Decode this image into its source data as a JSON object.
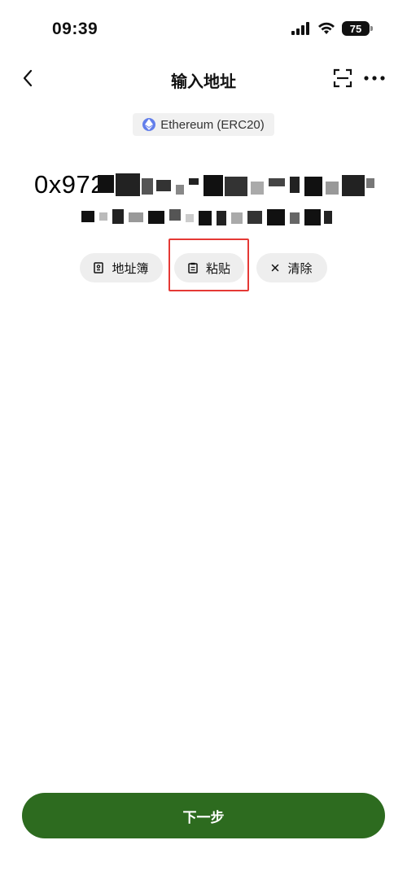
{
  "status_bar": {
    "time": "09:39",
    "battery": "75"
  },
  "nav": {
    "title": "输入地址"
  },
  "network": {
    "label": "Ethereum (ERC20)",
    "icon": "ethereum-icon",
    "color": "#627eea"
  },
  "address": {
    "visible_prefix": "0x972"
  },
  "actions": {
    "address_book_label": "地址簿",
    "paste_label": "粘贴",
    "clear_label": "清除"
  },
  "footer": {
    "next_label": "下一步",
    "button_color": "#2d6b1f"
  },
  "annotation": {
    "highlight_color": "#e53935"
  }
}
